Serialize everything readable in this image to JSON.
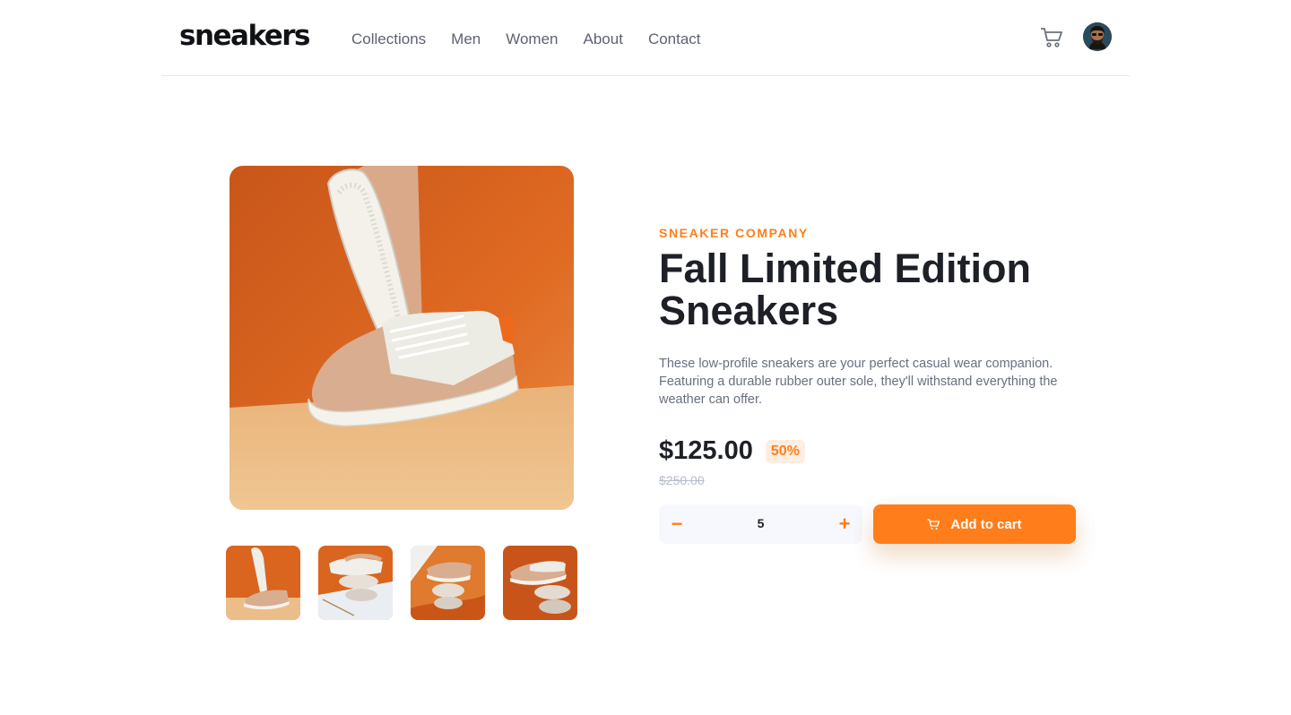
{
  "header": {
    "logo": "sneakers",
    "nav": [
      "Collections",
      "Men",
      "Women",
      "About",
      "Contact"
    ]
  },
  "icons": {
    "cart": "cart-icon",
    "avatar": "avatar",
    "minus": "minus-icon",
    "plus": "plus-icon"
  },
  "product": {
    "company": "SNEAKER COMPANY",
    "title": "Fall Limited Edition Sneakers",
    "description": "These low-profile sneakers are your perfect casual wear companion. Featuring a durable rubber outer sole, they'll withstand everything the weather can offer.",
    "price": "$125.00",
    "discount": "50%",
    "old_price": "$250.00",
    "quantity": "5",
    "minus_label": "−",
    "plus_label": "+",
    "add_to_cart": "Add to cart"
  },
  "gallery": {
    "thumbnail_count": 4
  },
  "colors": {
    "accent": "#ff7e1b",
    "accent_pale": "#ffede0",
    "text_dark": "#1d2026",
    "text_gray": "#68707d"
  }
}
